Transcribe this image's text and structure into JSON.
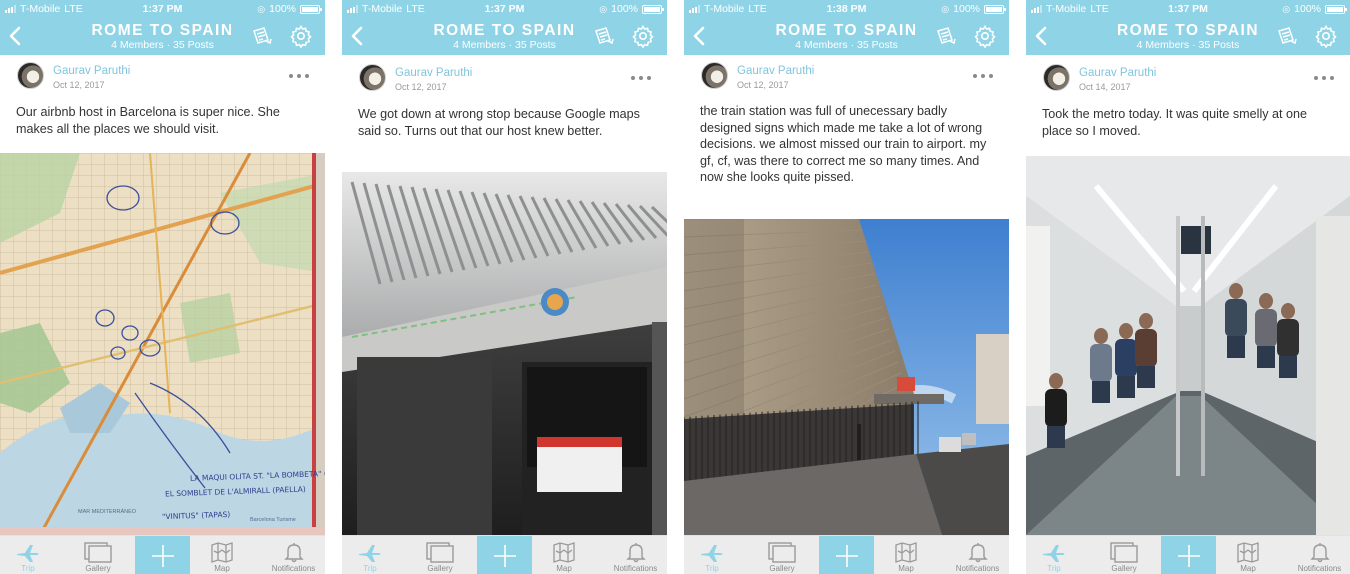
{
  "theme": {
    "accent": "#8fd3e6",
    "author_color": "#7fc5dd",
    "text": "#333333",
    "muted": "#9a9a9a"
  },
  "screens": [
    {
      "status": {
        "carrier": "T-Mobile",
        "network": "LTE",
        "time": "1:37 PM",
        "battery": "100%"
      },
      "nav": {
        "title": "ROME TO SPAIN",
        "subtitle": "4 Members · 35 Posts"
      },
      "post": {
        "author": "Gaurav Paruthi",
        "date": "Oct 12, 2017",
        "text": "Our airbnb host in Barcelona is super nice. She makes all the places we should visit.",
        "photo": "Barcelona street map with handwritten notes"
      },
      "map_notes": [
        "LA MAQUI OLITA ST. \"LA BOMBETA\" (TAPAS)",
        "EL SOMBLET DE L'ALMIRALL (PAELLA)",
        "\"VINITUS\" (TAPAS)"
      ],
      "map_labels": [
        "MAR MEDITERRÁNEO",
        "Barcelona Turisme"
      ]
    },
    {
      "status": {
        "carrier": "T-Mobile",
        "network": "LTE",
        "time": "1:37 PM",
        "battery": "100%"
      },
      "nav": {
        "title": "ROME TO SPAIN",
        "subtitle": "4 Members · 35 Posts"
      },
      "post": {
        "author": "Gaurav Paruthi",
        "date": "Oct 12, 2017",
        "text": "We got down at wrong stop because Google maps said so. Turns out that our host knew better.",
        "photo": "Metro train interior ceiling and doors"
      }
    },
    {
      "status": {
        "carrier": "T-Mobile",
        "network": "LTE",
        "time": "1:38 PM",
        "battery": "100%"
      },
      "nav": {
        "title": "ROME TO SPAIN",
        "subtitle": "4 Members · 35 Posts"
      },
      "post": {
        "author": "Gaurav Paruthi",
        "date": "Oct 12, 2017",
        "text": "the train station was full of unecessary badly designed  signs which made me take a lot of wrong decisions. we almost missed our train to airport. my gf, cf, was there to correct me so many times. And now she looks quite pissed.",
        "photo": "Street beside a tall stone wall under blue sky"
      }
    },
    {
      "status": {
        "carrier": "T-Mobile",
        "network": "LTE",
        "time": "1:37 PM",
        "battery": "100%"
      },
      "nav": {
        "title": "ROME TO SPAIN",
        "subtitle": "4 Members · 35 Posts"
      },
      "post": {
        "author": "Gaurav Paruthi",
        "date": "Oct 14, 2017",
        "text": "Took the metro today. It was quite smelly at one place so I moved.",
        "photo": "Passengers seated inside a metro car"
      }
    }
  ],
  "tabs": [
    {
      "label": "Trip",
      "icon": "airplane-icon",
      "active": true
    },
    {
      "label": "Gallery",
      "icon": "gallery-icon",
      "active": false
    },
    {
      "label": "Map",
      "icon": "map-icon",
      "active": false
    },
    {
      "label": "Notifications",
      "icon": "bell-icon",
      "active": false
    }
  ]
}
